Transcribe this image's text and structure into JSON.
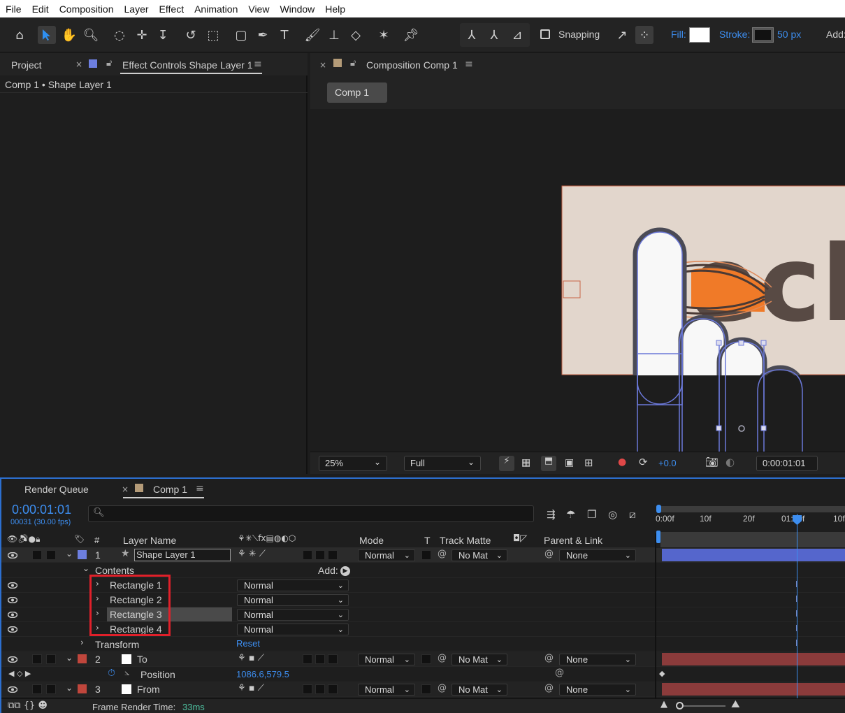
{
  "menu": [
    "File",
    "Edit",
    "Composition",
    "Layer",
    "Effect",
    "Animation",
    "View",
    "Window",
    "Help"
  ],
  "toolbar": {
    "snapping_label": "Snapping",
    "fill_label": "Fill:",
    "stroke_label": "Stroke:",
    "stroke_width": "50 px",
    "add_label": "Add:",
    "fill_color": "#ffffff",
    "stroke_color": "#111111"
  },
  "left_panel": {
    "tab_project": "Project",
    "tab_effect_controls": "Effect Controls Shape Layer 1",
    "breadcrumb": "Comp 1 • Shape Layer 1"
  },
  "comp_panel": {
    "tab_title": "Composition Comp 1",
    "comp_button": "Comp 1",
    "zoom": "25%",
    "resolution": "Full",
    "exposure": "+0.0",
    "timecode": "0:00:01:01",
    "canvas_text": "ecl"
  },
  "timeline": {
    "tab_render_queue": "Render Queue",
    "tab_comp": "Comp 1",
    "current_time": "0:00:01:01",
    "frame_info": "00031 (30.00 fps)",
    "ruler_labels": [
      "0:00f",
      "10f",
      "20f",
      "01:00f",
      "10f"
    ],
    "headers": {
      "number": "#",
      "layer_name": "Layer Name",
      "mode": "Mode",
      "t": "T",
      "track_matte": "Track Matte",
      "parent_link": "Parent & Link"
    },
    "layer1": {
      "number": "1",
      "name": "Shape Layer 1",
      "mode": "Normal",
      "track_matte": "No Mat",
      "parent": "None",
      "contents_label": "Contents",
      "add_label": "Add:",
      "rectangles": [
        {
          "name": "Rectangle 1",
          "mode": "Normal"
        },
        {
          "name": "Rectangle 2",
          "mode": "Normal"
        },
        {
          "name": "Rectangle 3",
          "mode": "Normal"
        },
        {
          "name": "Rectangle 4",
          "mode": "Normal"
        }
      ],
      "transform_label": "Transform",
      "reset_label": "Reset"
    },
    "layer2": {
      "number": "2",
      "name": "To",
      "mode": "Normal",
      "track_matte": "No Mat",
      "parent": "None",
      "position_label": "Position",
      "position_value": "1086.6,579.5"
    },
    "layer3": {
      "number": "3",
      "name": "From",
      "mode": "Normal",
      "track_matte": "No Mat",
      "parent": "None"
    },
    "frame_render_label": "Frame Render Time:",
    "frame_render_value": "33ms"
  },
  "colors": {
    "accent_blue": "#3d8ef0",
    "layer1_label": "#6d7fe0",
    "layer_red_label": "#c0463c",
    "highlight_box": "#e0202a",
    "layer1_bar": "#5566cc",
    "layer_red_bar": "#8b3b3b"
  }
}
